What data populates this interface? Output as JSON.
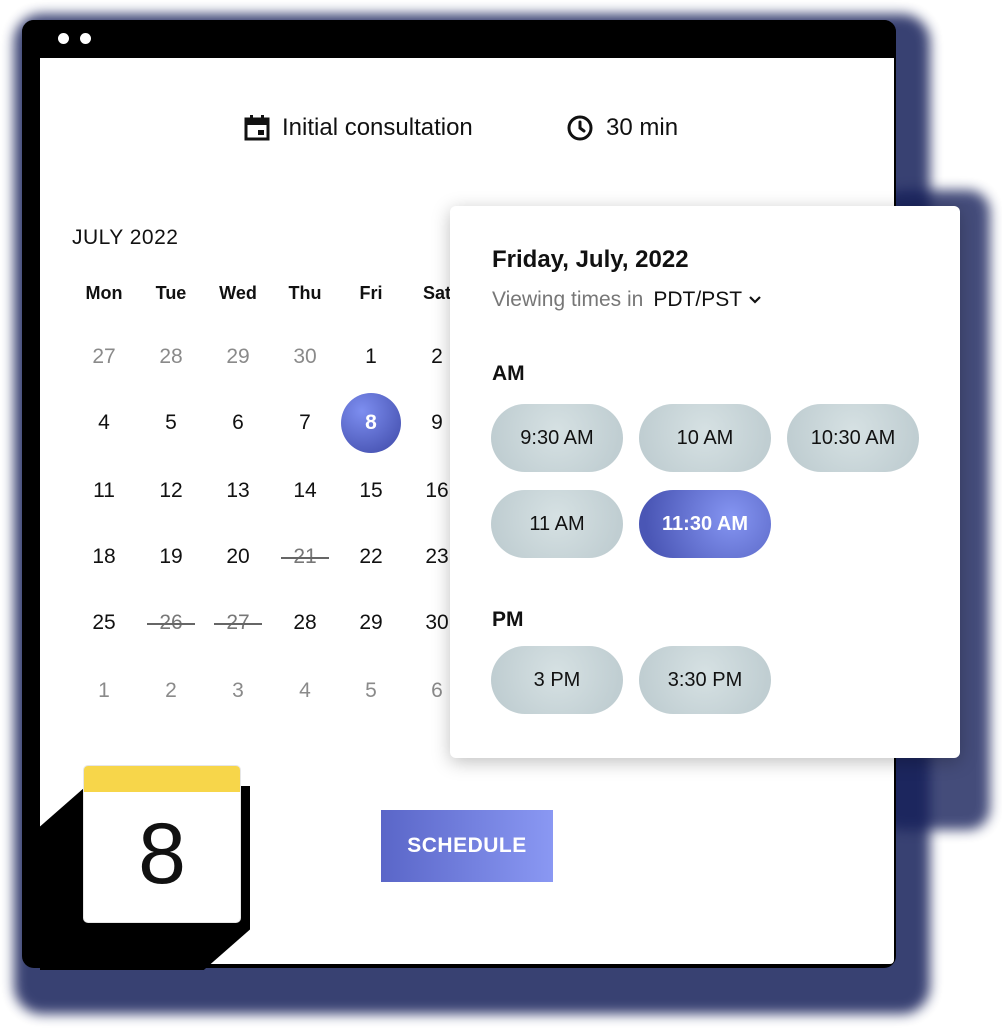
{
  "header": {
    "event_name": "Initial consultation",
    "duration": "30 min"
  },
  "calendar": {
    "month_title": "JULY 2022",
    "weekdays": [
      "Mon",
      "Tue",
      "Wed",
      "Thu",
      "Fri",
      "Sat"
    ],
    "weeks": [
      [
        "27",
        "28",
        "29",
        "30",
        "1",
        "2"
      ],
      [
        "4",
        "5",
        "6",
        "7",
        "8",
        "9"
      ],
      [
        "11",
        "12",
        "13",
        "14",
        "15",
        "16"
      ],
      [
        "18",
        "19",
        "20",
        "21",
        "22",
        "23"
      ],
      [
        "25",
        "26",
        "27",
        "28",
        "29",
        "30"
      ],
      [
        "1",
        "2",
        "3",
        "4",
        "5",
        "6"
      ]
    ],
    "selected_day": "8",
    "unavailable_days": [
      "21",
      "26",
      "27"
    ]
  },
  "time_picker": {
    "date_title": "Friday, July, 2022",
    "tz_prefix": "Viewing times in",
    "tz_value": "PDT/PST",
    "am_label": "AM",
    "pm_label": "PM",
    "am_slots": [
      "9:30 AM",
      "10 AM",
      "10:30 AM",
      "11 AM",
      "11:30 AM"
    ],
    "pm_slots": [
      "3 PM",
      "3:30 PM"
    ],
    "selected_slot": "11:30 AM"
  },
  "actions": {
    "schedule_label": "SCHEDULE"
  },
  "badge": {
    "day": "8"
  },
  "colors": {
    "accent": "#5b68d0",
    "slot_bg": "#c9d6d9",
    "badge_top": "#f7d64a",
    "window_frame": "#000000",
    "shadow": "#16205a"
  }
}
